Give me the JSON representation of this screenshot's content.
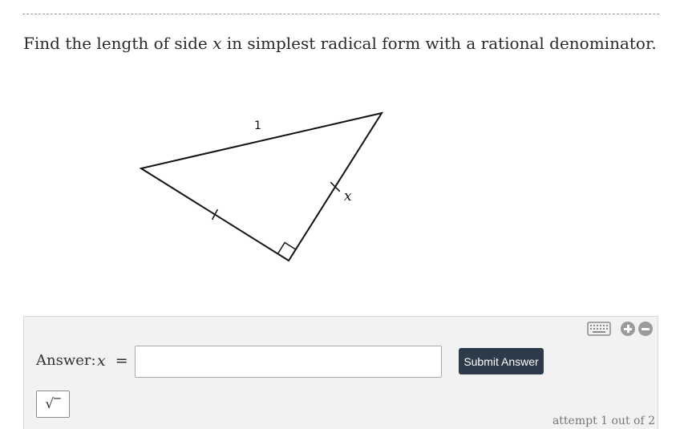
{
  "question": {
    "prefix": "Find the length of side ",
    "variable": "x",
    "suffix": " in simplest radical form with a rational denominator."
  },
  "figure": {
    "side_label": "1",
    "variable_label": "x",
    "vertices": {
      "top_right": [
        476,
        141
      ],
      "left": [
        176,
        210
      ],
      "bottom": [
        360,
        325
      ]
    }
  },
  "answer": {
    "label": "Answer:",
    "variable": "x",
    "equals": "=",
    "value": "",
    "placeholder": "",
    "submit_label": "Submit Answer",
    "sqrt_label": "√‾",
    "attempt_text": "attempt 1 out of 2"
  },
  "icons": {
    "keyboard": "keyboard-icon",
    "zoom_in": "zoom-in-icon",
    "zoom_out": "zoom-out-icon"
  },
  "colors": {
    "submit_bg": "#2d3a4a",
    "panel_bg": "#f2f2f2",
    "icon_gray": "#9b9b9b"
  }
}
